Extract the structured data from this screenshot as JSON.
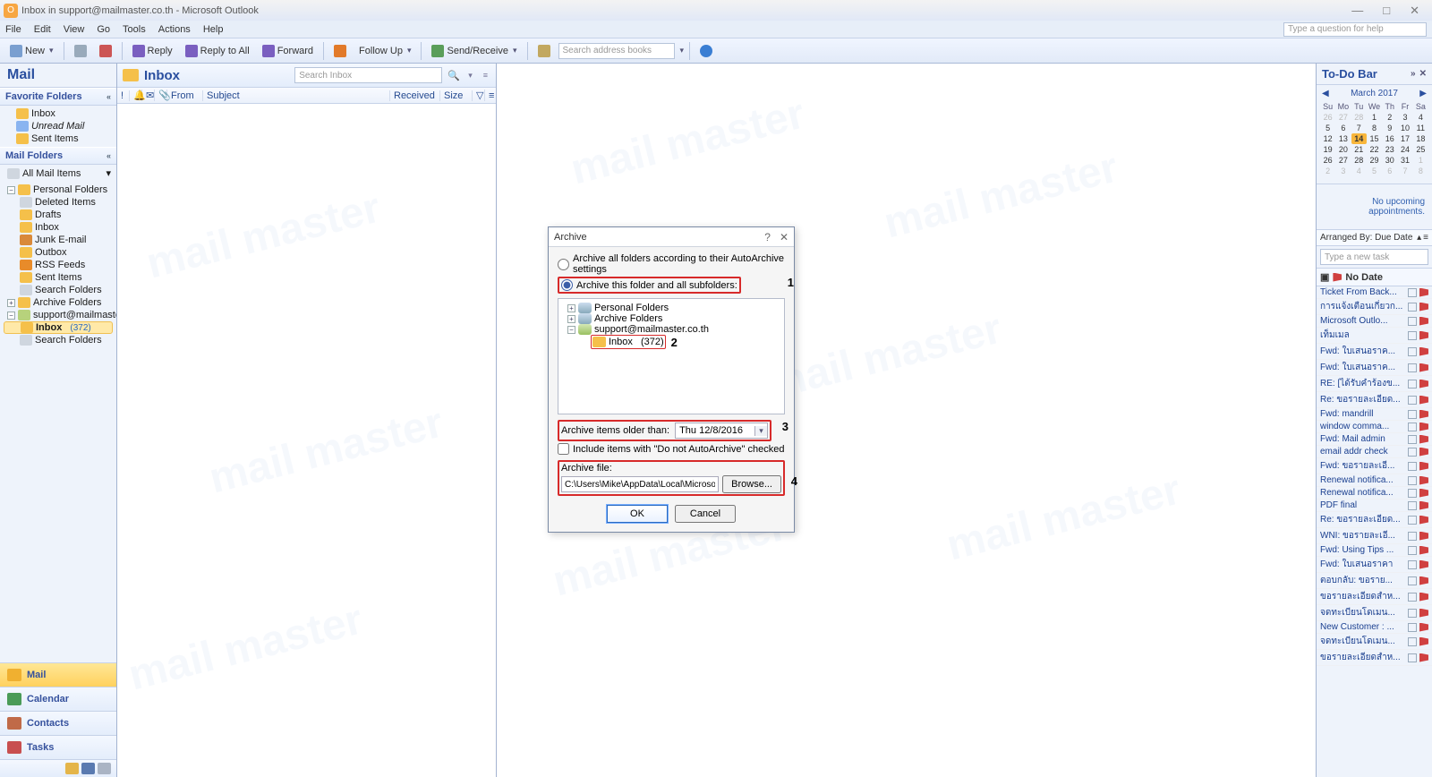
{
  "titlebar": {
    "text": "Inbox in support@mailmaster.co.th - Microsoft Outlook"
  },
  "winctrls": {
    "min": "—",
    "max": "□",
    "close": "✕"
  },
  "menubar": [
    "File",
    "Edit",
    "View",
    "Go",
    "Tools",
    "Actions",
    "Help"
  ],
  "helpbox_placeholder": "Type a question for help",
  "toolbar": {
    "new": "New",
    "reply": "Reply",
    "replyall": "Reply to All",
    "forward": "Forward",
    "followup": "Follow Up",
    "sendrecv": "Send/Receive",
    "search_placeholder": "Search address books"
  },
  "leftnav": {
    "title": "Mail",
    "fav_hdr": "Favorite Folders",
    "fav": [
      "Inbox",
      "Unread Mail",
      "Sent Items"
    ],
    "mailfolders_hdr": "Mail Folders",
    "all": "All Mail Items",
    "tree": {
      "pf": "Personal Folders",
      "pf_children": [
        "Deleted Items",
        "Drafts",
        "Inbox",
        "Junk E-mail",
        "Outbox",
        "RSS Feeds",
        "Sent Items",
        "Search Folders"
      ],
      "af": "Archive Folders",
      "acct": "support@mailmaster.co.th",
      "inbox": "Inbox",
      "inbox_cnt": "(372)",
      "acct_children": [
        "Search Folders"
      ]
    },
    "navs": [
      {
        "label": "Mail",
        "color": "#f0b030",
        "sel": true
      },
      {
        "label": "Calendar",
        "color": "#4a9b58"
      },
      {
        "label": "Contacts",
        "color": "#c06a48"
      },
      {
        "label": "Tasks",
        "color": "#c84f4f"
      }
    ]
  },
  "listpane": {
    "title": "Inbox",
    "search_placeholder": "Search Inbox",
    "cols": [
      "!",
      "",
      "",
      "",
      "From",
      "Subject",
      "Received",
      "Size",
      ""
    ]
  },
  "todobar": {
    "title": "To-Do Bar",
    "month": "March 2017",
    "dow": [
      "Su",
      "Mo",
      "Tu",
      "We",
      "Th",
      "Fr",
      "Sa"
    ],
    "weeks": [
      [
        "26",
        "27",
        "28",
        "1",
        "2",
        "3",
        "4"
      ],
      [
        "5",
        "6",
        "7",
        "8",
        "9",
        "10",
        "11"
      ],
      [
        "12",
        "13",
        "14",
        "15",
        "16",
        "17",
        "18"
      ],
      [
        "19",
        "20",
        "21",
        "22",
        "23",
        "24",
        "25"
      ],
      [
        "26",
        "27",
        "28",
        "29",
        "30",
        "31",
        "1"
      ],
      [
        "2",
        "3",
        "4",
        "5",
        "6",
        "7",
        "8"
      ]
    ],
    "today_row": 2,
    "today_col": 2,
    "off_rows_start": [
      0
    ],
    "off_rows_end": [
      4,
      5
    ],
    "noappt": "No upcoming appointments.",
    "arrange": "Arranged By: Due Date",
    "newtask_placeholder": "Type a new task",
    "group": "No Date",
    "tasks": [
      "Ticket From Back...",
      "การแจ้งเตือนเกี่ยวก...",
      "Microsoft Outlo...",
      "เท็มเมล",
      "Fwd: ใบเสนอราค...",
      "Fwd: ใบเสนอราค...",
      "RE: [ได้รับคำร้องข...",
      "Re: ขอรายละเอียด...",
      "Fwd: mandrill",
      "window comma...",
      "Fwd: Mail admin",
      "email addr check",
      "Fwd: ขอรายละเอี...",
      "Renewal notifica...",
      "Renewal notifica...",
      "PDF final",
      "Re: ขอรายละเอียด...",
      "WNI: ขอรายละเอี...",
      "Fwd: Using Tips ...",
      "Fwd: ใบเสนอราคา",
      "ตอบกลับ: ขอราย...",
      "ขอรายละเอียดสำห...",
      "จดทะเบียนโดเมน...",
      "New Customer : ...",
      "จดทะเบียนโดเมน...",
      "ขอรายละเอียดสำห..."
    ]
  },
  "dialog": {
    "title": "Archive",
    "opt1": "Archive all folders according to their AutoArchive settings",
    "opt2": "Archive this folder and all subfolders:",
    "n1": "1",
    "n2": "2",
    "n3": "3",
    "n4": "4",
    "tree": {
      "pf": "Personal Folders",
      "af": "Archive Folders",
      "acct": "support@mailmaster.co.th",
      "inbox": "Inbox",
      "inbox_cnt": "(372)"
    },
    "older_label": "Archive items older than:",
    "older_value": "Thu 12/8/2016",
    "include_chk": "Include items with \"Do not AutoArchive\" checked",
    "file_label": "Archive file:",
    "file_value": "C:\\Users\\Mike\\AppData\\Local\\Microsoft\\Outlook\\a",
    "browse": "Browse...",
    "ok": "OK",
    "cancel": "Cancel"
  }
}
